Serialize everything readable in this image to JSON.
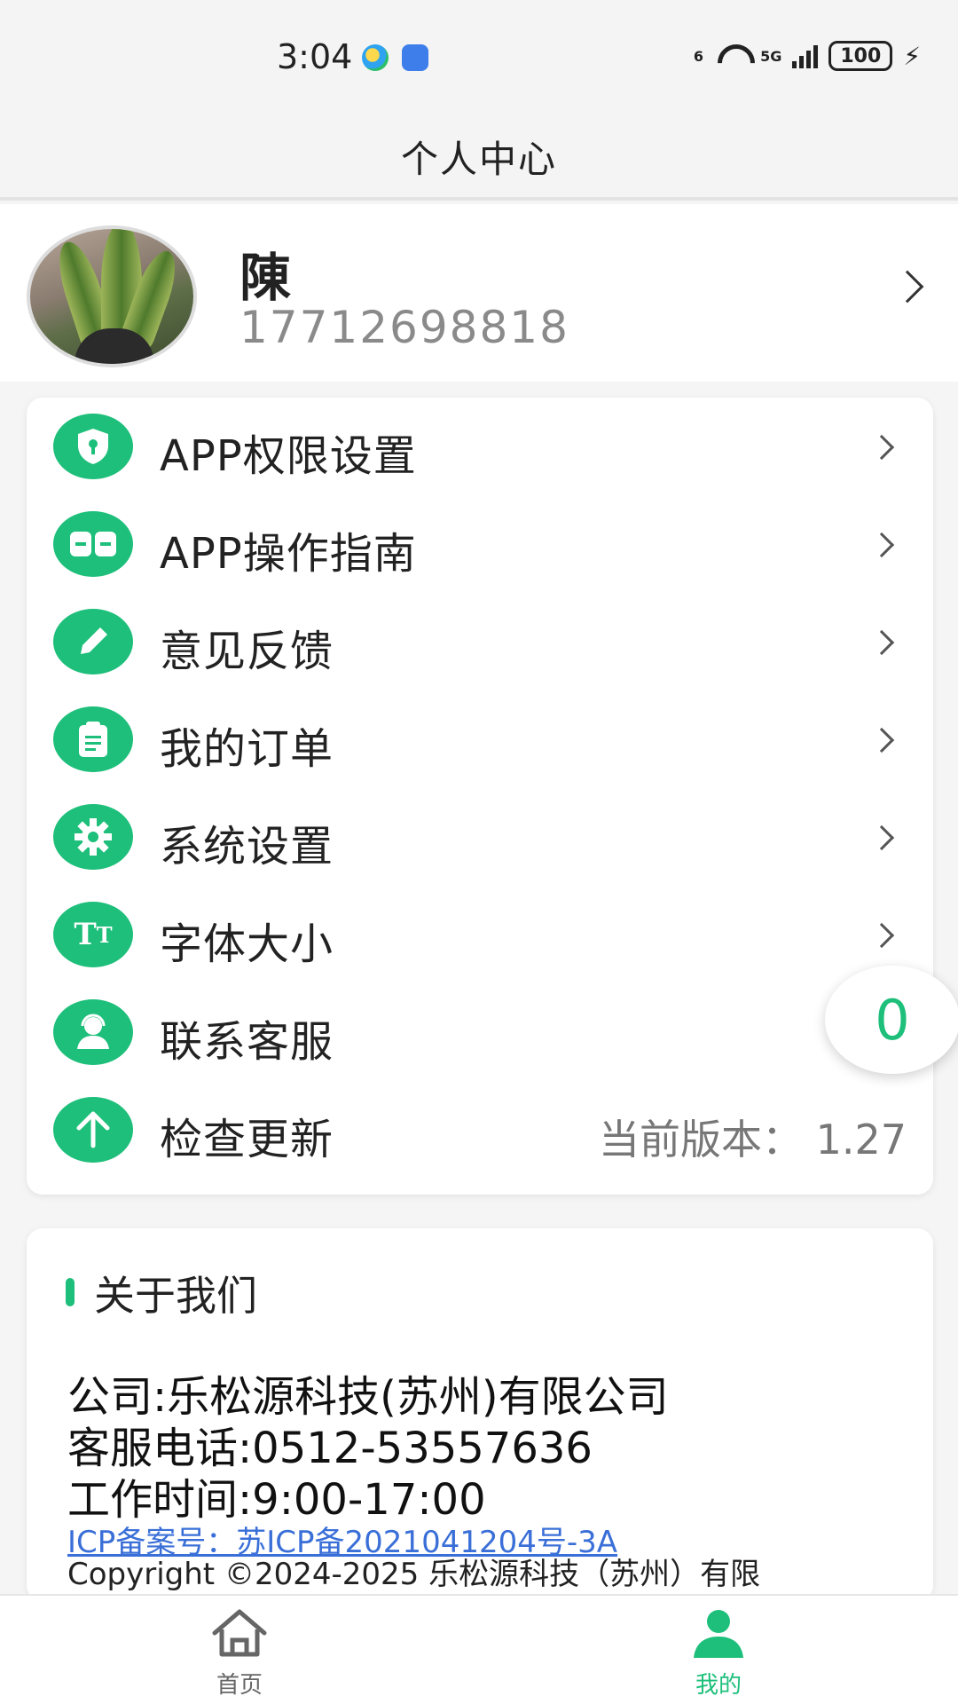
{
  "status_bar": {
    "time": "3:04",
    "wifi_label": "6",
    "network_label": "5G",
    "battery": "100"
  },
  "header": {
    "title": "个人中心"
  },
  "profile": {
    "name": "陳",
    "phone": "17712698818"
  },
  "menu": {
    "items": [
      {
        "label": "APP权限设置",
        "icon": "shield-lock-icon"
      },
      {
        "label": "APP操作指南",
        "icon": "guide-book-icon"
      },
      {
        "label": "意见反馈",
        "icon": "pencil-icon"
      },
      {
        "label": "我的订单",
        "icon": "clipboard-icon"
      },
      {
        "label": "系统设置",
        "icon": "gear-icon"
      },
      {
        "label": "字体大小",
        "icon": "font-size-icon"
      },
      {
        "label": "联系客服",
        "icon": "customer-service-icon"
      },
      {
        "label": "检查更新",
        "icon": "arrow-up-icon",
        "value": "当前版本： 1.27"
      }
    ]
  },
  "floating_badge": {
    "count": "0"
  },
  "about": {
    "title": "关于我们",
    "company": "公司:乐松源科技(苏州)有限公司",
    "phone": "客服电话:0512-53557636",
    "hours": "工作时间:9:00-17:00",
    "icp": "ICP备案号：苏ICP备2021041204号-3A",
    "copyright": "Copyright ©2024-2025 乐松源科技（苏州）有限"
  },
  "tabbar": {
    "home_label": "首页",
    "me_label": "我的"
  },
  "colors": {
    "accent": "#1dbf7a",
    "link": "#3a6fd8"
  }
}
